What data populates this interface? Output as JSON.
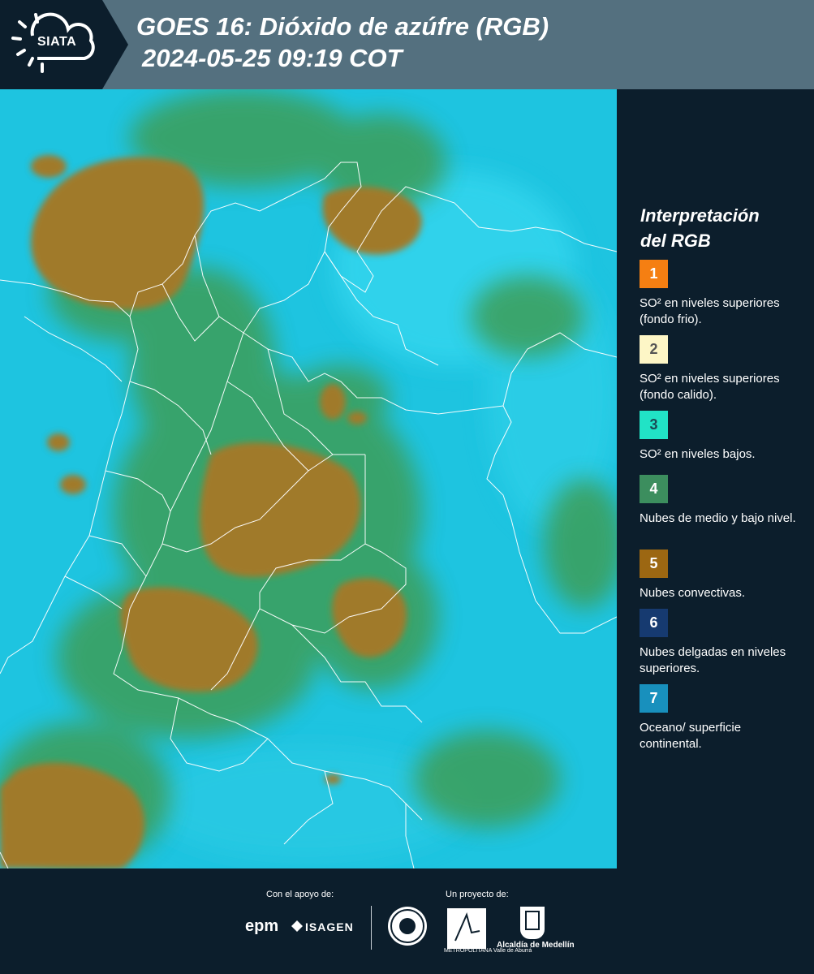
{
  "header": {
    "brand": "SIATA",
    "title_line1": "GOES 16: Dióxido de azúfre (RGB)",
    "title_line2": "2024-05-25 09:19 COT",
    "background_color": "#54707f",
    "logo_block_color": "#0c1e2c"
  },
  "map": {
    "product": "GOES 16 SO2 RGB",
    "ocean_color": "#1fc6e2",
    "convective_cloud_color": "#a07a2b",
    "mid_low_cloud_color": "#3c9a5a",
    "border_color": "#ffffff"
  },
  "legend": {
    "title_line1": "Interpretación",
    "title_line2": "del RGB",
    "items": [
      {
        "number": "1",
        "text": "SO² en niveles superiores (fondo frio).",
        "color": "#f57f12",
        "number_color": "#ffffff"
      },
      {
        "number": "2",
        "text": "SO² en niveles superiores (fondo calido).",
        "color": "#fdf6c6",
        "number_color": "#555555"
      },
      {
        "number": "3",
        "text": "SO² en niveles bajos.",
        "color": "#21e3c6",
        "number_color": "#1a4a55"
      },
      {
        "number": "4",
        "text": "Nubes de medio y bajo nivel.",
        "color": "#3c8e5e",
        "number_color": "#ffffff"
      },
      {
        "number": "5",
        "text": "Nubes convectivas.",
        "color": "#9c6712",
        "number_color": "#ffffff"
      },
      {
        "number": "6",
        "text": "Nubes delgadas en niveles superiores.",
        "color": "#163a70",
        "number_color": "#ffffff"
      },
      {
        "number": "7",
        "text": "Oceano/ superficie continental.",
        "color": "#1890bd",
        "number_color": "#ffffff"
      }
    ]
  },
  "footer": {
    "support_label": "Con el apoyo de:",
    "project_label": "Un proyecto de:",
    "sponsors": [
      "epm",
      "ISAGEN"
    ],
    "partners": [
      "Área Metropolitana",
      "Alcaldía de Medellín"
    ],
    "area_caption": "METROPOLITANA Valle de Aburrá",
    "alcaldia_label": "Alcaldía de Medellín"
  }
}
